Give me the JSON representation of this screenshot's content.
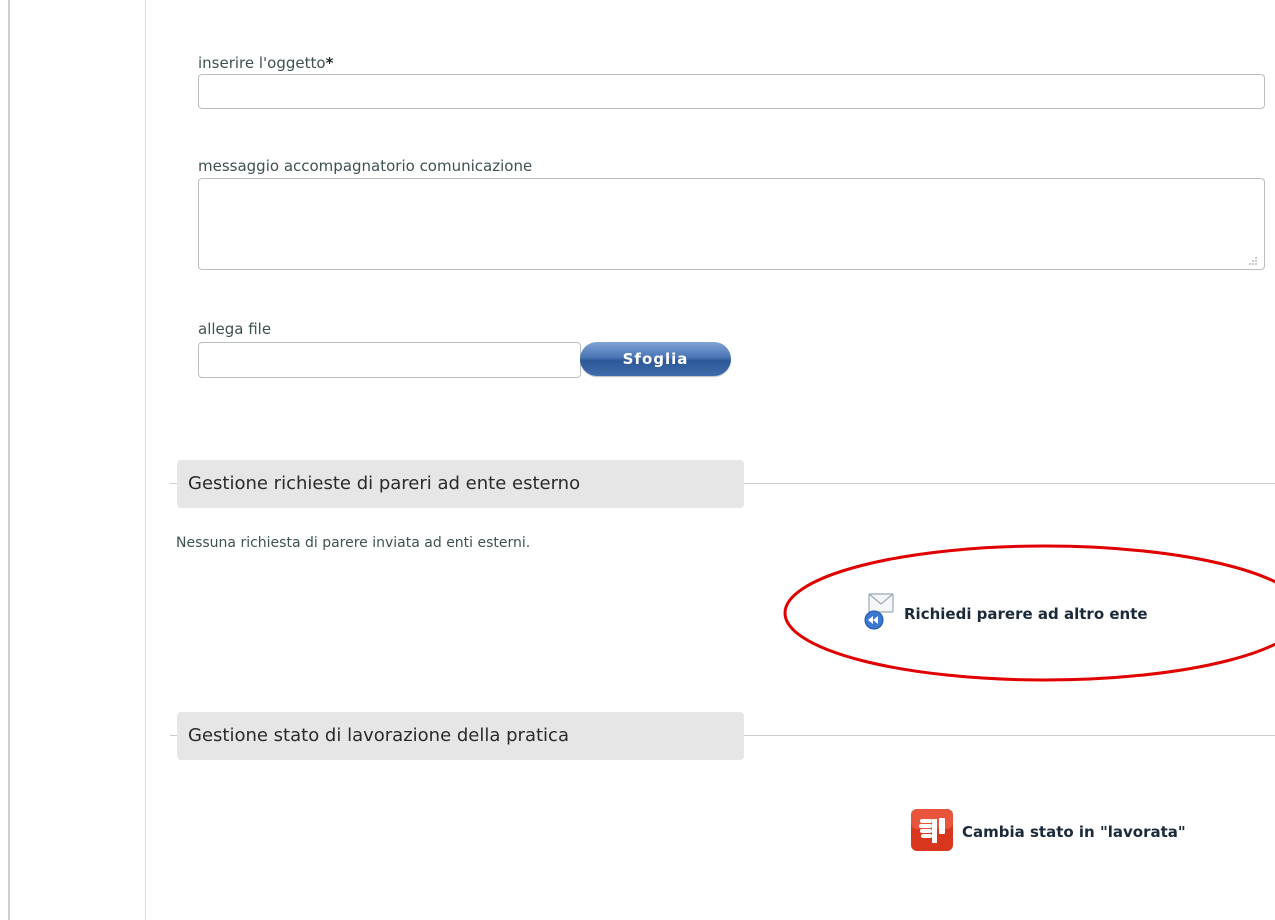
{
  "form": {
    "subject": {
      "label": "inserire l'oggetto",
      "required_mark": "*",
      "value": ""
    },
    "message": {
      "label": "messaggio accompagnatorio comunicazione",
      "value": ""
    },
    "attach": {
      "label": "allega file",
      "value": "",
      "browse_label": "Sfoglia"
    }
  },
  "external_opinions": {
    "header": "Gestione richieste di pareri ad ente esterno",
    "empty_text": "Nessuna richiesta di parere inviata ad enti esterni.",
    "action_label": "Richiedi parere ad altro ente",
    "action_icon": "envelope-reply-icon",
    "highlight_color": "#e00000"
  },
  "work_state": {
    "header": "Gestione stato di lavorazione della pratica",
    "action_label": "Cambia stato in \"lavorata\"",
    "action_icon": "thumbs-down-icon",
    "icon_color": "#d9361e"
  }
}
